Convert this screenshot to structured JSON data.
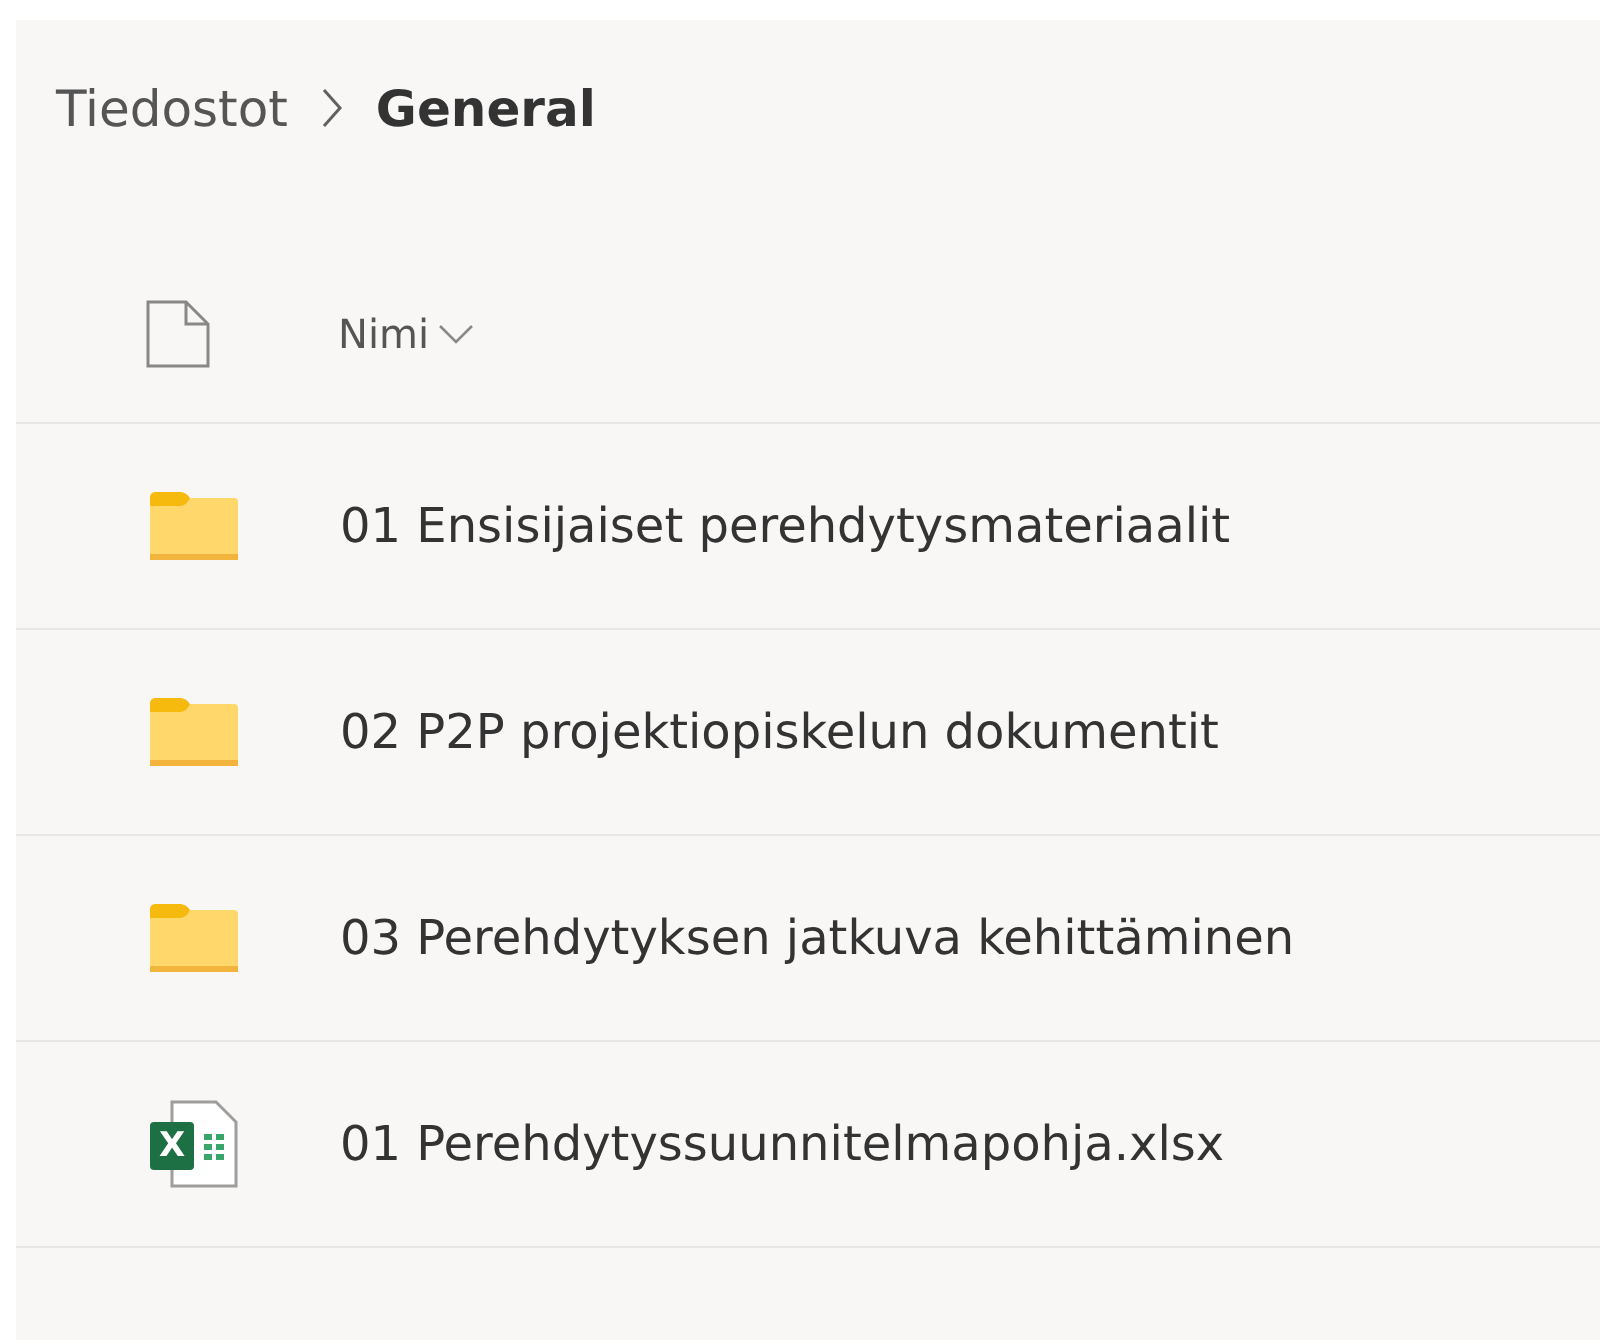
{
  "breadcrumb": [
    {
      "label": "Tiedostot",
      "current": false
    },
    {
      "label": "General",
      "current": true
    }
  ],
  "header": {
    "column": "Nimi",
    "sorted": true
  },
  "files": [
    {
      "kind": "folder",
      "name": "01 Ensisijaiset perehdytysmateriaalit"
    },
    {
      "kind": "folder",
      "name": "02 P2P projektiopiskelun dokumentit"
    },
    {
      "kind": "folder",
      "name": "03 Perehdytyksen jatkuva kehittäminen"
    },
    {
      "kind": "excel",
      "name": "01 Perehdytyssuunnitelmapohja.xlsx",
      "icon_letter": "X"
    }
  ]
}
